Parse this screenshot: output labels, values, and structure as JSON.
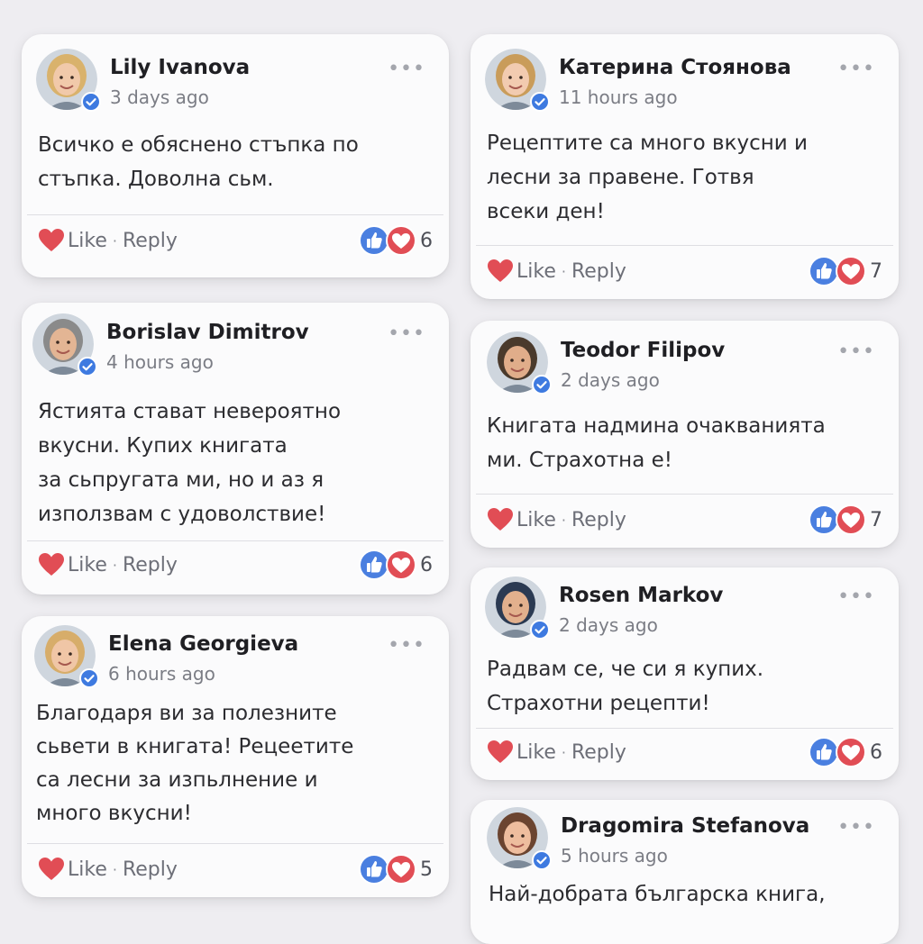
{
  "reaction_colors": {
    "like": "#4a7fe0",
    "love": "#e14d55",
    "verified": "#3e7ae0"
  },
  "comments": [
    {
      "name": "Lily Ivanova",
      "time": "3 days ago",
      "lines": [
        "Всичко е обяснено стъпка по",
        "стъпка. Доволна сьм."
      ],
      "like": "Like",
      "reply": "Reply",
      "count": "6",
      "avatar_hair": "#d9b26c",
      "avatar_skin": "#f1c9aa"
    },
    {
      "name": "Катерина Стоянова",
      "time": "11 hours ago",
      "lines": [
        "Рецептите са много вкусни и",
        "лесни за правене. Готвя",
        "всеки ден!"
      ],
      "like": "Like",
      "reply": "Reply",
      "count": "7",
      "avatar_hair": "#c99c5a",
      "avatar_skin": "#f2cbb0"
    },
    {
      "name": "Borislav Dimitrov",
      "time": "4 hours ago",
      "lines": [
        "Ястията стават невероятно",
        "вкусни. Купих книгата",
        "за сьпругата ми, но и аз я",
        "използвам с удоволствие!"
      ],
      "like": "Like",
      "reply": "Reply",
      "count": "6",
      "avatar_hair": "#8a8a8a",
      "avatar_skin": "#e3b594"
    },
    {
      "name": "Teodor Filipov",
      "time": "2 days ago",
      "lines": [
        "Книгата надмина очакванията",
        "ми. Страхотна е!"
      ],
      "like": "Like",
      "reply": "Reply",
      "count": "7",
      "avatar_hair": "#4a3a2c",
      "avatar_skin": "#e0ad8a"
    },
    {
      "name": "Elena Georgieva",
      "time": "6 hours ago",
      "lines": [
        "Благодаря ви за полезните",
        "сьвети в книгата! Рецеетите",
        "са лесни за изпьлнение и",
        "много вкусни!"
      ],
      "like": "Like",
      "reply": "Reply",
      "count": "5",
      "avatar_hair": "#d7ad6a",
      "avatar_skin": "#f0c6a6"
    },
    {
      "name": "Rosen Markov",
      "time": "2 days ago",
      "lines": [
        "Радвам се, че си я купих.",
        "Страхотни рецепти!"
      ],
      "like": "Like",
      "reply": "Reply",
      "count": "6",
      "avatar_hair": "#2b3a52",
      "avatar_skin": "#e2b08d"
    },
    {
      "name": "Dragomira Stefanova",
      "time": "5 hours ago",
      "lines": [
        "Най-добрата българска книга,"
      ],
      "like": "Like",
      "reply": "Reply",
      "count": "",
      "avatar_hair": "#6b4430",
      "avatar_skin": "#eebd9e"
    }
  ]
}
